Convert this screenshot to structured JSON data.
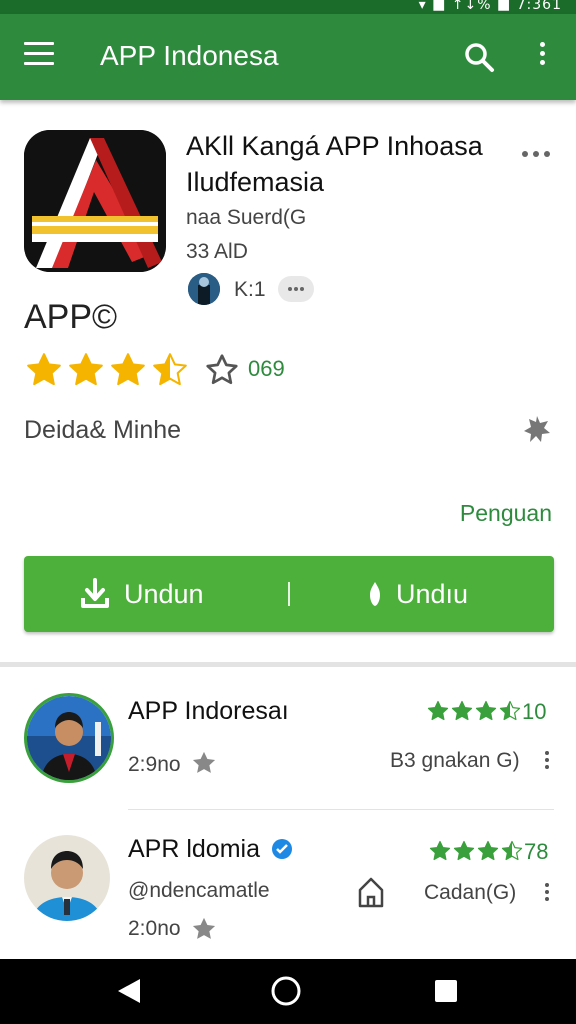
{
  "status": {
    "text": "▾ ■ ↑↓% ■ 7:361"
  },
  "appbar": {
    "title": "APP Indonesa",
    "menu_icon": "hamburger-menu-icon",
    "search_icon": "search-icon",
    "more_icon": "more-vert-icon"
  },
  "app": {
    "name": "AKll Kangá APP Inhoasa Iludfemasia",
    "developer": "naa Suerd(G",
    "size": "33 AlD",
    "installs": "K:1",
    "brand": "APP©",
    "rating_stars": 3.5,
    "rating_count": "069",
    "category": "Deida& Minhe",
    "link": "Penguan",
    "download_label": "Undun",
    "download_label_2": "Undıu",
    "accent": "#4cb03a",
    "appbar_color": "#2e8b3e"
  },
  "list": [
    {
      "name": "APP Indoresaı",
      "sub": "2:9no",
      "rating": "10",
      "stars": 3.5,
      "size": "B3 gnakan G)"
    },
    {
      "name": "APR ldomia",
      "handle": "@ndencamatle",
      "sub": "2:0no",
      "rating": "78",
      "stars": 3.5,
      "size": "Cadan(G)",
      "verified_icon": "verified-badge-icon"
    }
  ],
  "navbar": {
    "back_icon": "back-triangle-icon",
    "home_icon": "home-circle-icon",
    "recents_icon": "recents-square-icon"
  }
}
